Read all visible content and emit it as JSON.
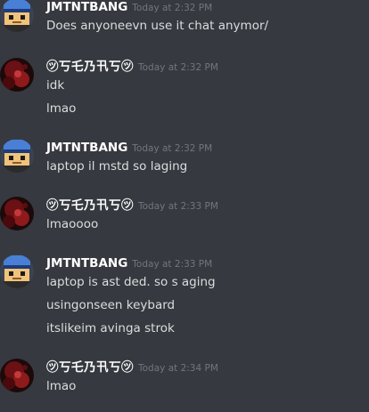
{
  "groups": [
    {
      "user": "JMTNTBANG",
      "avatar": "pixel-avatar-icon",
      "time": "Today at 2:32 PM",
      "messages": [
        "Does anyoneevn use it chat anymor/"
      ]
    },
    {
      "user": "㋡丂乇乃卂丂㋡",
      "avatar": "dark-red-avatar-icon",
      "time": "Today at 2:32 PM",
      "messages": [
        "idk",
        "lmao"
      ]
    },
    {
      "user": "JMTNTBANG",
      "avatar": "pixel-avatar-icon",
      "time": "Today at 2:32 PM",
      "messages": [
        "laptop il mstd so  laging"
      ]
    },
    {
      "user": "㋡丂乇乃卂丂㋡",
      "avatar": "dark-red-avatar-icon",
      "time": "Today at 2:33 PM",
      "messages": [
        "lmaoooo"
      ]
    },
    {
      "user": "JMTNTBANG",
      "avatar": "pixel-avatar-icon",
      "time": "Today at 2:33 PM",
      "messages": [
        "laptop is ast ded. so s aging",
        "usingonseen keybard",
        "itslikeim avinga strok"
      ]
    },
    {
      "user": "㋡丂乇乃卂丂㋡",
      "avatar": "dark-red-avatar-icon",
      "time": "Today at 2:34 PM",
      "messages": [
        "lmao"
      ]
    }
  ],
  "colors": {
    "background": "#36393f",
    "username": "#ffffff",
    "timestamp": "#72767d",
    "message": "#dcddde"
  }
}
